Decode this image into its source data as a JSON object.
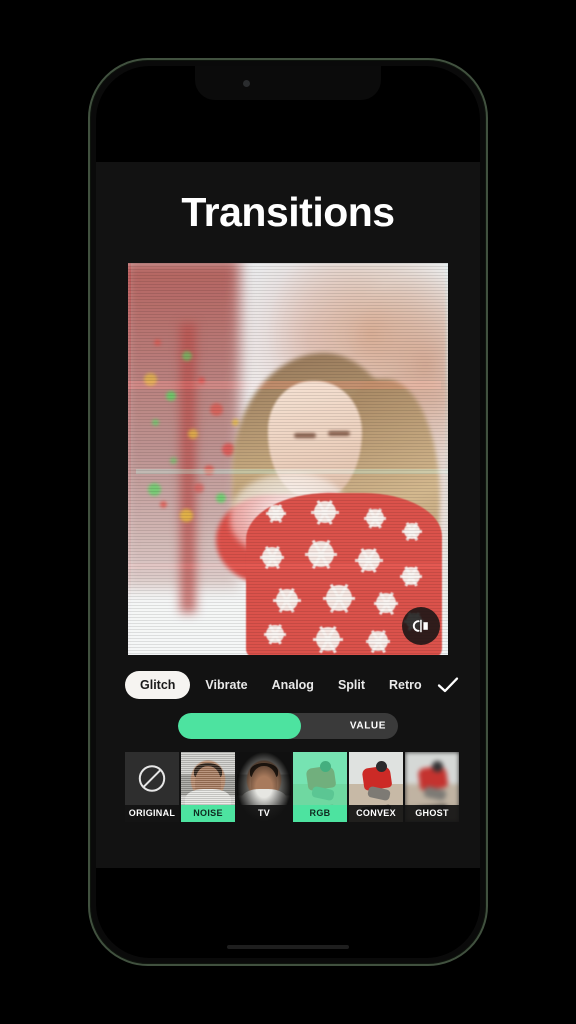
{
  "device": {
    "frame_color": "#41513f",
    "notch_camera": "front-camera-dot"
  },
  "app": {
    "title": "Transitions",
    "background": "#121212",
    "accent": "#4de3a0"
  },
  "preview": {
    "description": "Woman in red and white snowflake Christmas sweater blowing snow, RGB glitch effect applied",
    "compare_icon": "before-after-compare-icon"
  },
  "tabs": {
    "items": [
      {
        "label": "Glitch",
        "active": true
      },
      {
        "label": "Vibrate",
        "active": false
      },
      {
        "label": "Analog",
        "active": false
      },
      {
        "label": "Split",
        "active": false
      },
      {
        "label": "Retro",
        "active": false
      }
    ],
    "confirm_icon": "checkmark-icon"
  },
  "slider": {
    "label": "VALUE",
    "fill_percent": 56,
    "fill_color": "#4de3a0",
    "track_color": "#3a3a3a"
  },
  "filters": {
    "items": [
      {
        "label": "ORIGINAL",
        "selected": false,
        "highlight": false,
        "icon": "no-entry-icon"
      },
      {
        "label": "NOISE",
        "selected": false,
        "highlight": true,
        "icon": ""
      },
      {
        "label": "TV",
        "selected": false,
        "highlight": false,
        "icon": ""
      },
      {
        "label": "RGB",
        "selected": true,
        "highlight": true,
        "icon": ""
      },
      {
        "label": "CONVEX",
        "selected": false,
        "highlight": false,
        "icon": ""
      },
      {
        "label": "GHOST",
        "selected": false,
        "highlight": false,
        "icon": ""
      }
    ]
  }
}
